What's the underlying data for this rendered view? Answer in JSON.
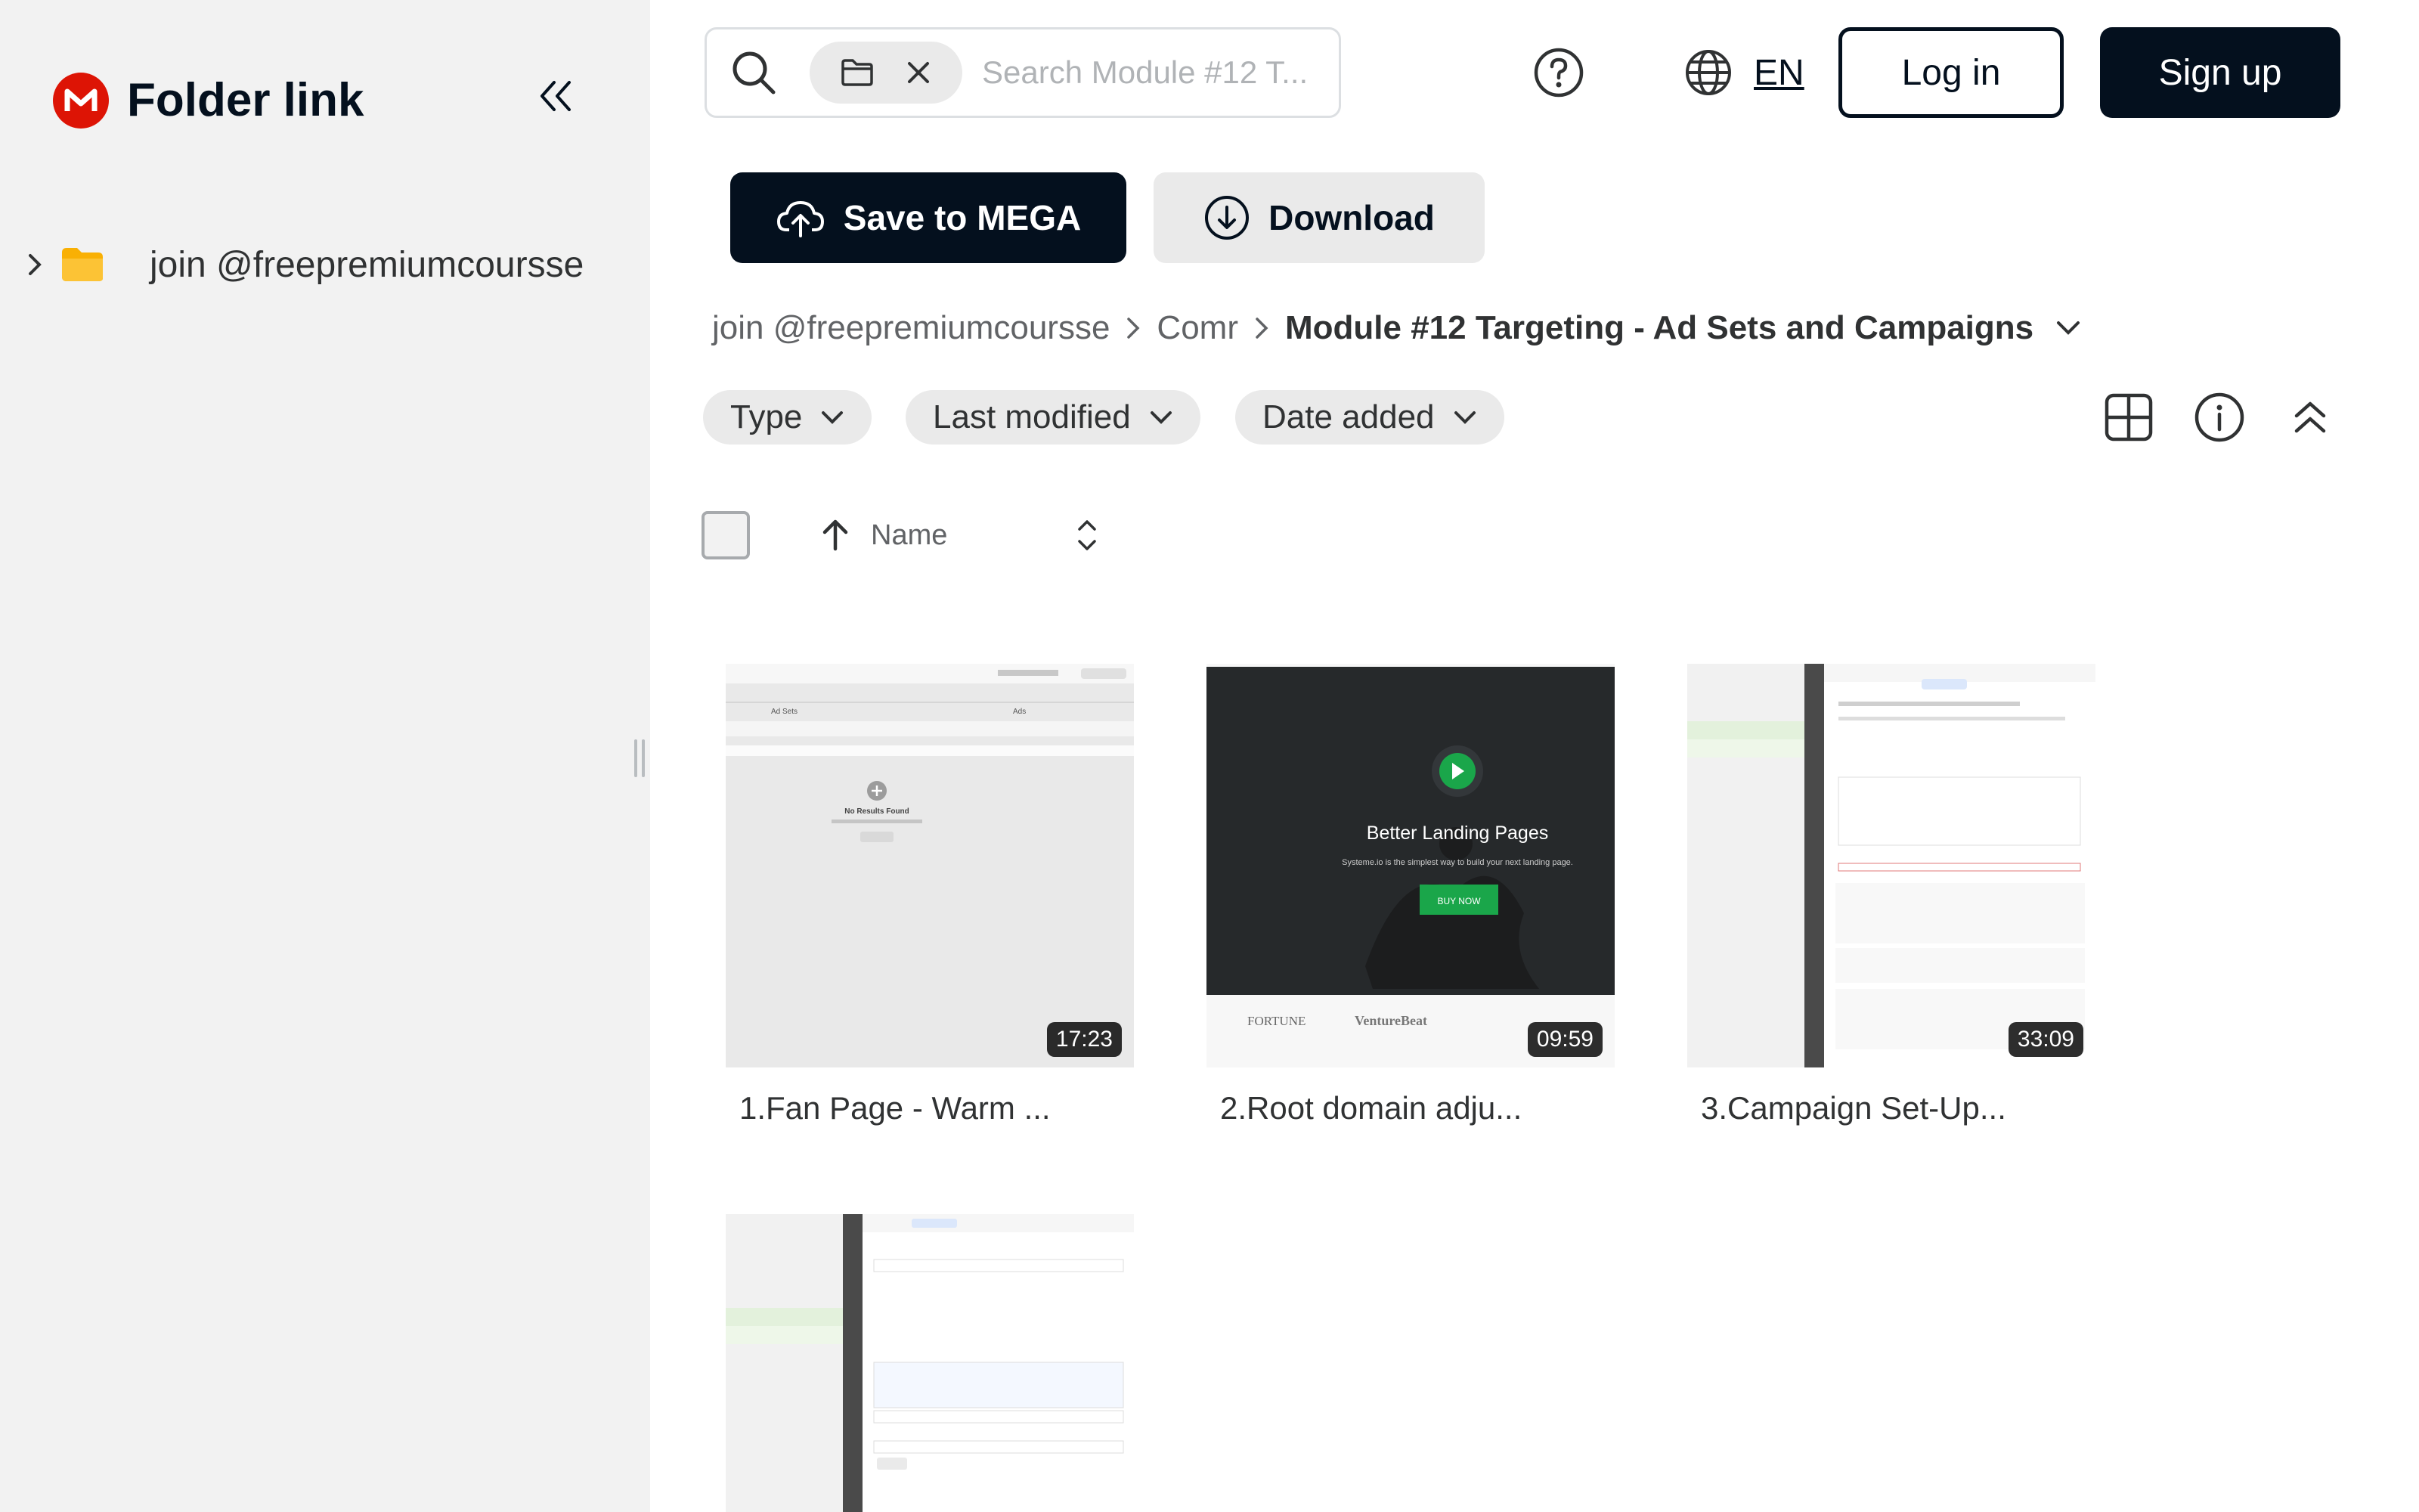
{
  "sidebar": {
    "title": "Folder link",
    "tree": [
      {
        "label": "join @freepremiumcoursse"
      }
    ]
  },
  "search": {
    "placeholder": "Search Module #12 T..."
  },
  "header": {
    "lang": "EN",
    "login_label": "Log in",
    "signup_label": "Sign up"
  },
  "actions": {
    "save_label": "Save to MEGA",
    "download_label": "Download"
  },
  "breadcrumb": {
    "root": "join @freepremiumcoursse",
    "middle": "Comr",
    "current": "Module #12 Targeting - Ad Sets and Campaigns"
  },
  "filters": {
    "type": "Type",
    "last_modified": "Last modified",
    "date_added": "Date added"
  },
  "list_header": {
    "name": "Name"
  },
  "thumbnail_text": {
    "landing_title": "Better Landing Pages",
    "landing_sub": "Systeme.io is the simplest way to build your next landing page.",
    "landing_btn": "BUY NOW",
    "logo1": "FORTUNE",
    "logo2": "VentureBeat",
    "no_results": "No Results Found",
    "ad_sets": "Ad Sets",
    "ads": "Ads"
  },
  "files": [
    {
      "name": "1.Fan Page - Warm ...",
      "duration": "17:23"
    },
    {
      "name": "2.Root domain adju...",
      "duration": "09:59"
    },
    {
      "name": "3.Campaign Set-Up...",
      "duration": "33:09"
    },
    {
      "name": "",
      "duration": ""
    }
  ],
  "colors": {
    "brand_red": "#dd1405",
    "dark": "#04101e",
    "folder": "#f9b004",
    "play_green": "#1aa64a"
  }
}
